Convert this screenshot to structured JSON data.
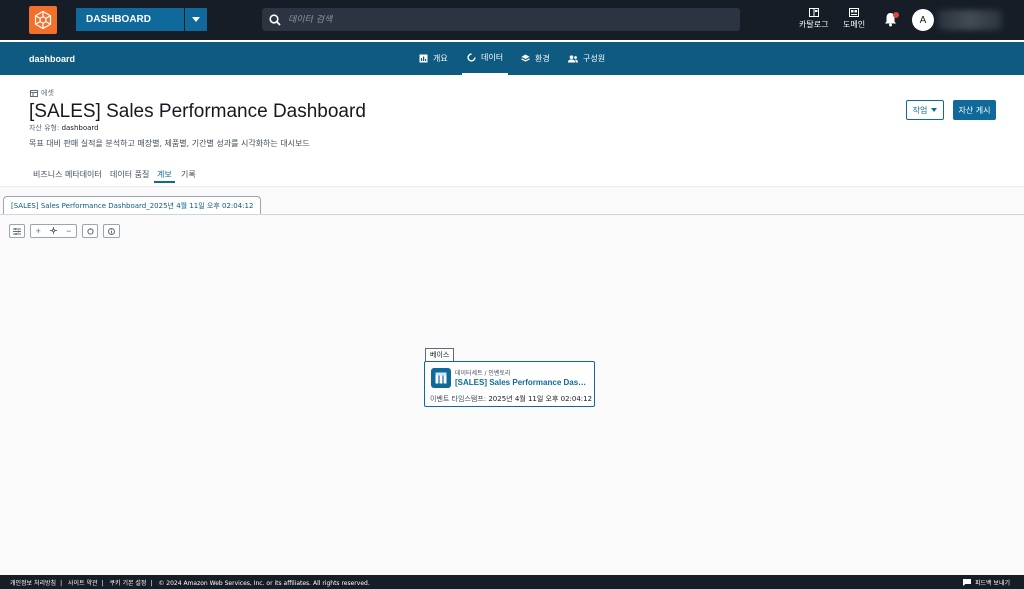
{
  "topbar": {
    "project_name": "DASHBOARD",
    "search_placeholder": "데이터 검색",
    "catalog_label": "카탈로그",
    "domain_label": "도메인",
    "avatar_initial": "A"
  },
  "subnav": {
    "project": "dashboard",
    "tabs": [
      {
        "label": "개요",
        "icon": "chart-icon"
      },
      {
        "label": "데이터",
        "icon": "data-icon"
      },
      {
        "label": "환경",
        "icon": "layers-icon"
      },
      {
        "label": "구성원",
        "icon": "members-icon"
      }
    ],
    "active_tab": "데이터"
  },
  "asset": {
    "tag": "에셋",
    "title": "[SALES] Sales Performance Dashboard",
    "type_label": "자산 유형:",
    "type_value": "dashboard",
    "description": "목표 대비 판매 실적을 분석하고 매장별, 제품별, 기간별 성과를 시각화하는 대시보드",
    "action_button": "작업",
    "publish_button": "자산 게시"
  },
  "content_tabs": [
    {
      "label": "비즈니스 메타데이터"
    },
    {
      "label": "데이터 품질"
    },
    {
      "label": "계보"
    },
    {
      "label": "기록"
    }
  ],
  "active_content_tab": "계보",
  "lineage": {
    "version_chip": "[SALES] Sales Performance Dashboard_2025년 4월 11일 오후 02:04:12",
    "node_label": "베이스",
    "node": {
      "type": "데이터세트 / 인벤토리",
      "name": "[SALES] Sales Performance Dashboard",
      "timestamp_label": "이벤트 타임스탬프:",
      "timestamp_value": "2025년 4월 11일 오후 02:04:12"
    }
  },
  "footer": {
    "privacy": "개인정보 처리방침",
    "site_terms": "사이트 약관",
    "cookie": "쿠키 기본 설정",
    "copyright": "© 2024 Amazon Web Services, Inc. or its affiliates. All rights reserved.",
    "feedback": "피드백 보내기"
  },
  "colors": {
    "topbar_bg": "#161d26",
    "subnav_bg": "#0f5a80",
    "accent": "#0f6a9b",
    "logo": "#f2702a"
  }
}
